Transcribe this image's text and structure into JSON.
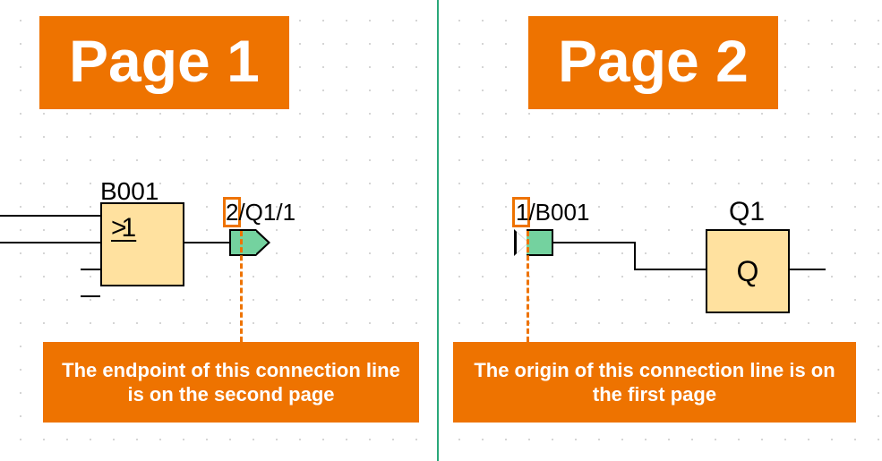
{
  "colors": {
    "accent": "#ee7300",
    "block": "#ffe19f",
    "connector": "#74d29f",
    "divider": "#2aa87a"
  },
  "page1": {
    "title": "Page 1",
    "block": {
      "name": "B001",
      "symbol_text": ">1",
      "type": "OR-gate"
    },
    "connector": {
      "label_full": "2/Q1/1",
      "highlighted_char": "2",
      "kind": "outgoing"
    },
    "callout": "The endpoint of this connection line is on the second page"
  },
  "page2": {
    "title": "Page 2",
    "connector": {
      "label_full": "1/B001",
      "highlighted_char": "1",
      "kind": "incoming"
    },
    "block": {
      "name": "Q1",
      "symbol_text": "Q",
      "type": "output"
    },
    "callout": "The origin of this connection line is on the first page"
  }
}
